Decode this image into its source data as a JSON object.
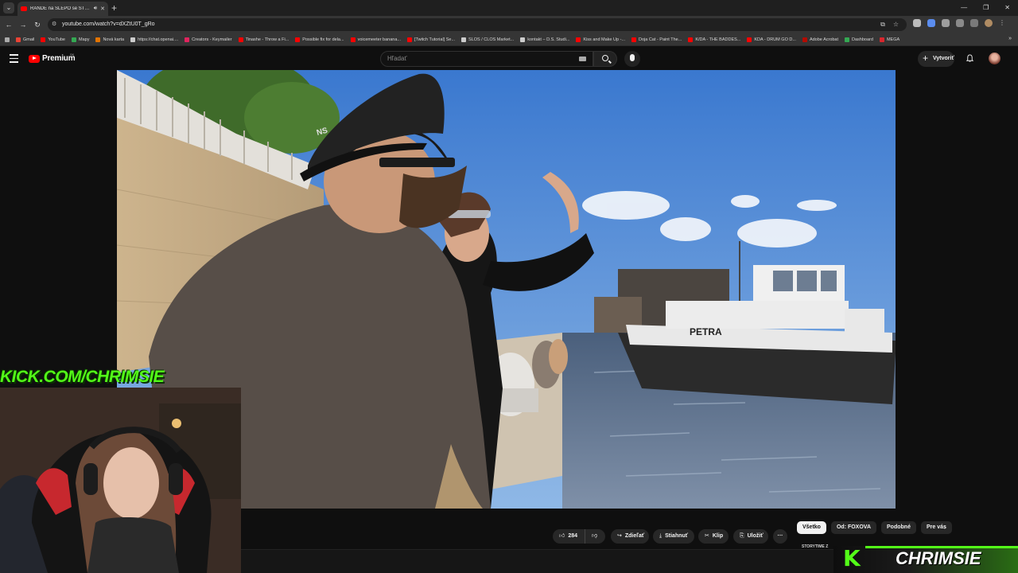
{
  "browser": {
    "active_tab_title": "RANDE na SLEPO se STREAMEREM",
    "url": "youtube.com/watch?v=dXZtU0T_gRo",
    "bookmarks": [
      {
        "label": "Gmail",
        "color": "#ea4335"
      },
      {
        "label": "YouTube",
        "color": "#ff0000"
      },
      {
        "label": "Mapy",
        "color": "#34a853"
      },
      {
        "label": "Nová karta",
        "color": "#e37400"
      },
      {
        "label": "https://chat.openai....",
        "color": "#cccccc"
      },
      {
        "label": "Creators - Keymailer",
        "color": "#e0245e"
      },
      {
        "label": "Tinashe - Throw a Fi...",
        "color": "#ff0000"
      },
      {
        "label": "Possible fix for dela...",
        "color": "#ff0000"
      },
      {
        "label": "voicemeeter banana...",
        "color": "#ff0000"
      },
      {
        "label": "[Twitch Tutorial] Se...",
        "color": "#ff0000"
      },
      {
        "label": "SLOS / CLOS Market...",
        "color": "#cccccc"
      },
      {
        "label": "kontakt – D.S. Studi...",
        "color": "#cccccc"
      },
      {
        "label": "Kiss and Make Up -...",
        "color": "#ff0000"
      },
      {
        "label": "Doja Cat - Paint The...",
        "color": "#ff0000"
      },
      {
        "label": "K/DA - THE BADDES...",
        "color": "#ff0000"
      },
      {
        "label": "KDA - DRUM GO D...",
        "color": "#ff0000"
      },
      {
        "label": "Adobe Acrobat",
        "color": "#b30b00"
      },
      {
        "label": "Dashboard",
        "color": "#34a853"
      },
      {
        "label": "MEGA",
        "color": "#d9272e"
      }
    ]
  },
  "youtube": {
    "logo": "Premium",
    "country": "SK",
    "search_placeholder": "Hľadať",
    "create_label": "Vytvoriť",
    "actions": {
      "like_count": "284",
      "share": "Zdieľať",
      "download": "Stiahnuť",
      "clip": "Klip",
      "save": "Uložiť",
      "more": "···"
    },
    "chips": [
      "Všetko",
      "Od: FOXOVA",
      "Podobné",
      "Pre vás"
    ],
    "storytime": "STORYTIME Z"
  },
  "video_scene": {
    "boat_name": "PETRA",
    "cap_text": "NS"
  },
  "overlay": {
    "kick_url": "KICK.COM/CHRIMSIE",
    "banner_name": "CHRIMSIE",
    "banner_logo": "K",
    "accent": "#53fc18"
  }
}
